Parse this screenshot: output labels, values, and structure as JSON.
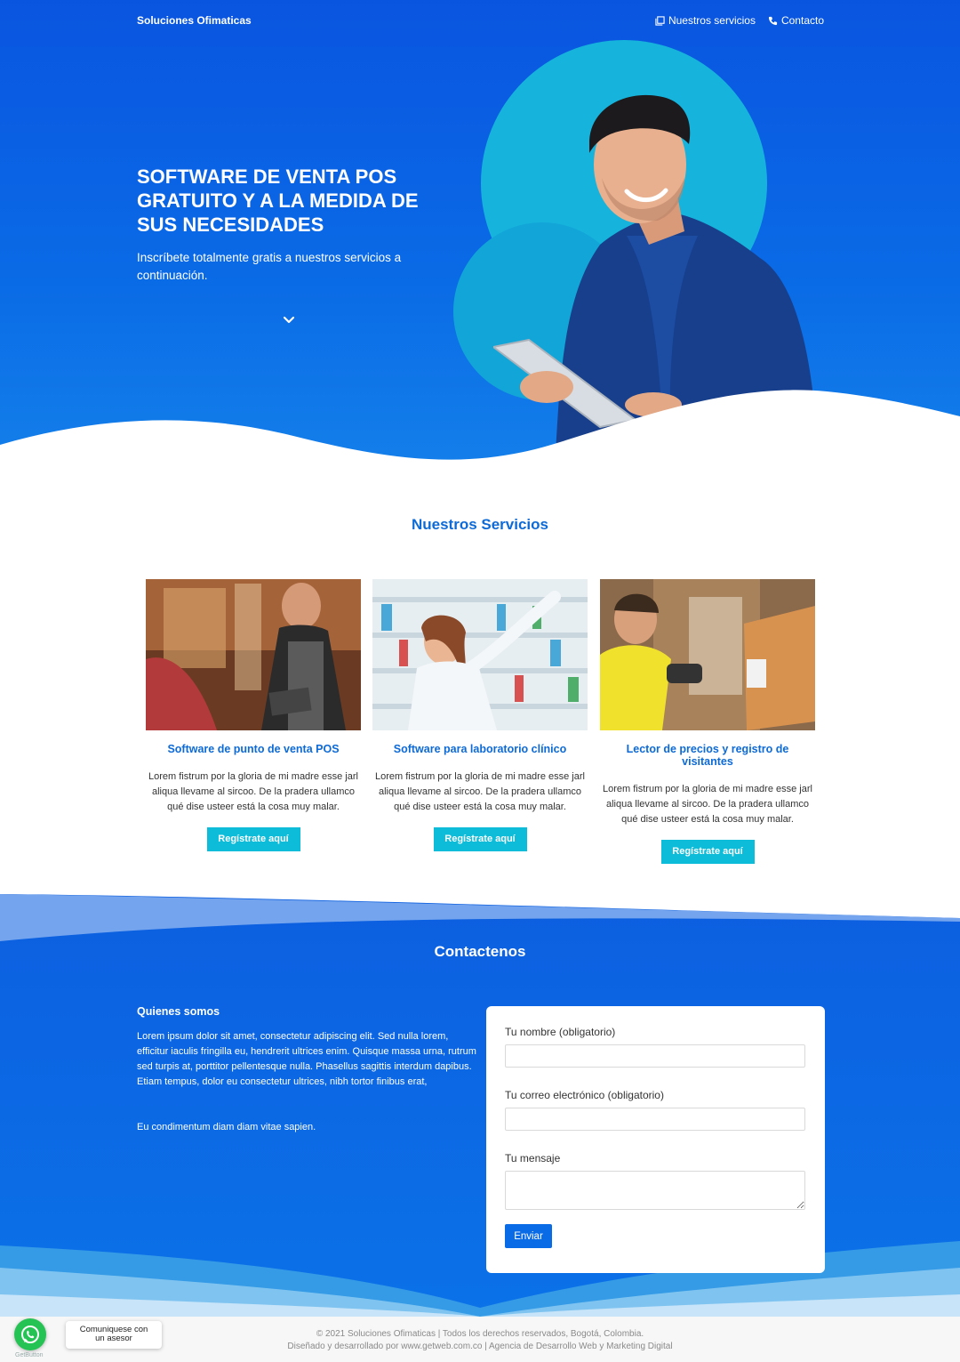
{
  "header": {
    "brand": "Soluciones Ofimaticas",
    "nav": [
      {
        "label": "Nuestros servicios",
        "icon": "copy-icon"
      },
      {
        "label": "Contacto",
        "icon": "phone-icon"
      }
    ]
  },
  "hero": {
    "title": "SOFTWARE DE VENTA POS GRATUITO Y A LA MEDIDA DE SUS NECESIDADES",
    "subtitle": "Inscríbete totalmente gratis a nuestros servicios a continuación.",
    "scroll_icon": "chevron-down-icon"
  },
  "services": {
    "title": "Nuestros Servicios",
    "cards": [
      {
        "title": "Software de punto de venta POS",
        "text": "Lorem fistrum por la gloria de mi madre esse jarl aliqua llevame al sircoo. De la pradera ullamco qué dise usteer está la cosa muy malar.",
        "button": "Regístrate aquí"
      },
      {
        "title": "Software para laboratorio clínico",
        "text": "Lorem fistrum por la gloria de mi madre esse jarl aliqua llevame al sircoo. De la pradera ullamco qué dise usteer está la cosa muy malar.",
        "button": "Regístrate aquí"
      },
      {
        "title": "Lector de precios y registro de visitantes",
        "text": "Lorem fistrum por la gloria de mi madre esse jarl aliqua llevame al sircoo. De la pradera ullamco qué dise usteer está la cosa muy malar.",
        "button": "Regístrate aquí"
      }
    ]
  },
  "contact": {
    "title": "Contactenos",
    "about_title": "Quienes somos",
    "about_text": "Lorem ipsum dolor sit amet, consectetur adipiscing elit. Sed nulla lorem, efficitur iaculis fringilla eu, hendrerit ultrices enim. Quisque massa urna, rutrum sed turpis at, porttitor pellentesque nulla. Phasellus sagittis interdum dapibus. Etiam tempus, dolor eu consectetur ultrices, nibh tortor finibus erat,",
    "about_text2": "Eu condimentum diam diam vitae sapien.",
    "form": {
      "name_label": "Tu nombre (obligatorio)",
      "name_value": "",
      "email_label": "Tu correo electrónico (obligatorio)",
      "email_value": "",
      "message_label": "Tu mensaje",
      "message_value": "",
      "submit": "Enviar"
    }
  },
  "footer": {
    "line1": "© 2021 Soluciones Ofimaticas | Todos los derechos reservados, Bogotá, Colombia.",
    "line2": "Diseñado y desarrollado por www.getweb.com.co | Agencia de Desarrollo Web y Marketing Digital"
  },
  "whatsapp": {
    "icon": "whatsapp-icon",
    "tooltip_line1": "Comuniquese con",
    "tooltip_line2": "un asesor",
    "brand": "GetButton"
  },
  "colors": {
    "primary_blue": "#0a6be6",
    "accent_cyan": "#0dbcd8",
    "title_blue": "#0d6ad6",
    "whatsapp_green": "#25c254"
  }
}
